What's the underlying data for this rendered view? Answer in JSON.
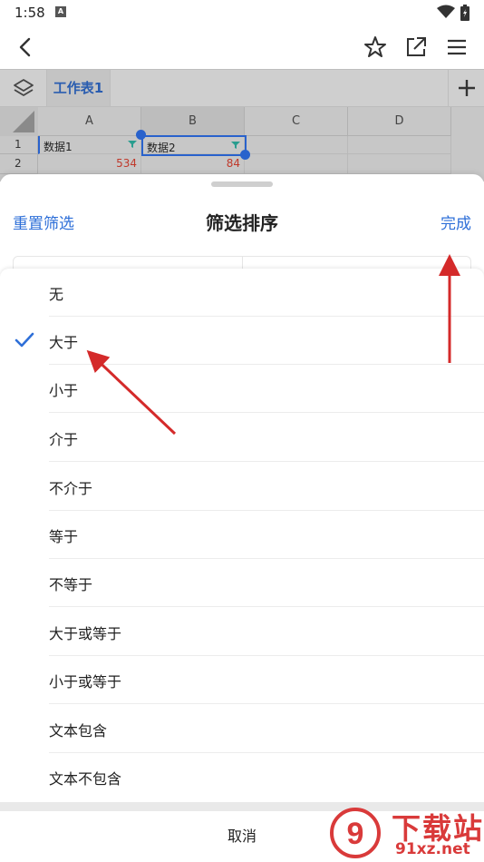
{
  "status_bar": {
    "time": "1:58",
    "sim_label": "A"
  },
  "toolbar": {},
  "sheet_tabs": {
    "active": "工作表1"
  },
  "grid": {
    "columns": [
      "A",
      "B",
      "C",
      "D"
    ],
    "rows": [
      "1",
      "2"
    ],
    "cells": {
      "a1": "数据1",
      "b1": "数据2",
      "a2": "534",
      "b2": "84"
    }
  },
  "filter_sheet": {
    "reset_label": "重置筛选",
    "title": "筛选排序",
    "done_label": "完成"
  },
  "options": [
    {
      "label": "无",
      "checked": false
    },
    {
      "label": "大于",
      "checked": true
    },
    {
      "label": "小于",
      "checked": false
    },
    {
      "label": "介于",
      "checked": false
    },
    {
      "label": "不介于",
      "checked": false
    },
    {
      "label": "等于",
      "checked": false
    },
    {
      "label": "不等于",
      "checked": false
    },
    {
      "label": "大于或等于",
      "checked": false
    },
    {
      "label": "小于或等于",
      "checked": false
    },
    {
      "label": "文本包含",
      "checked": false
    },
    {
      "label": "文本不包含",
      "checked": false
    }
  ],
  "cancel_label": "取消",
  "watermark": {
    "title": "下载站",
    "domain": "91xz.net"
  },
  "colors": {
    "accent": "#2e6fd8",
    "number": "#c0392b",
    "annotation": "#d42a2a"
  }
}
